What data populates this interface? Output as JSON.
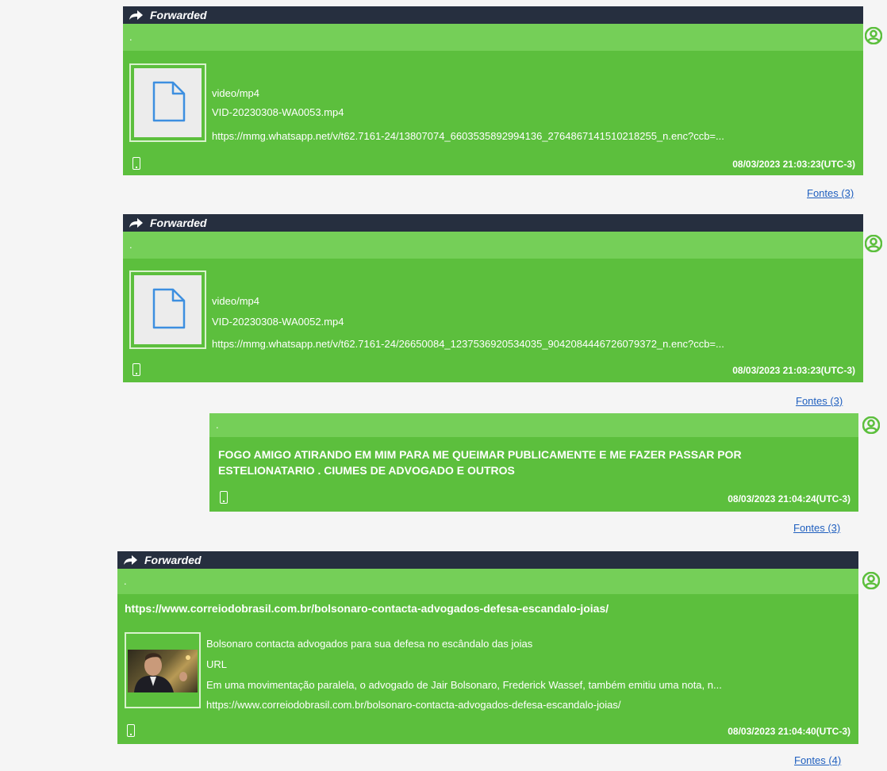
{
  "messages": [
    {
      "forwarded_label": "Forwarded",
      "top_text": ".",
      "mime": "video/mp4",
      "filename": "VID-20230308-WA0053.mp4",
      "url": "https://mmg.whatsapp.net/v/t62.7161-24/13807074_6603535892994136_2764867141510218255_n.enc?ccb=...",
      "timestamp": "08/03/2023 21:03:23(UTC-3)",
      "sources": "Fontes (3)",
      "icons": [
        "forward-arrow-icon",
        "file-icon",
        "phone-icon",
        "avatar-icon"
      ]
    },
    {
      "forwarded_label": "Forwarded",
      "top_text": ".",
      "mime": "video/mp4",
      "filename": "VID-20230308-WA0052.mp4",
      "url": "https://mmg.whatsapp.net/v/t62.7161-24/26650084_1237536920534035_9042084446726079372_n.enc?ccb=...",
      "timestamp": "08/03/2023 21:03:23(UTC-3)",
      "sources": "Fontes (3)"
    },
    {
      "top_text": ".",
      "body_line1": "FOGO AMIGO ATIRANDO EM MIM PARA ME QUEIMAR  PUBLICAMENTE E ME FAZER PASSAR POR",
      "body_line2": "ESTELIONATARIO .  CIUMES DE ADVOGADO E OUTROS",
      "timestamp": "08/03/2023 21:04:24(UTC-3)",
      "sources": "Fontes (3)"
    },
    {
      "forwarded_label": "Forwarded",
      "top_text": ".",
      "link": "https://www.correiodobrasil.com.br/bolsonaro-contacta-advogados-defesa-escandalo-joias/",
      "preview_title": "Bolsonaro contacta advogados para sua defesa no escândalo das joias",
      "preview_type": "URL",
      "preview_desc": "Em uma movimentação paralela, o advogado de Jair Bolsonaro, Frederick Wassef, também emitiu uma nota, n...",
      "preview_url": "https://www.correiodobrasil.com.br/bolsonaro-contacta-advogados-defesa-escandalo-joias/",
      "timestamp": "08/03/2023 21:04:40(UTC-3)",
      "sources": "Fontes (4)"
    }
  ],
  "colors": {
    "bubble": "#5cbf3d",
    "strip": "#75cf58",
    "forwarded_bar": "#262f3f",
    "link": "#1f5fbf",
    "background": "#f5f5f5"
  }
}
